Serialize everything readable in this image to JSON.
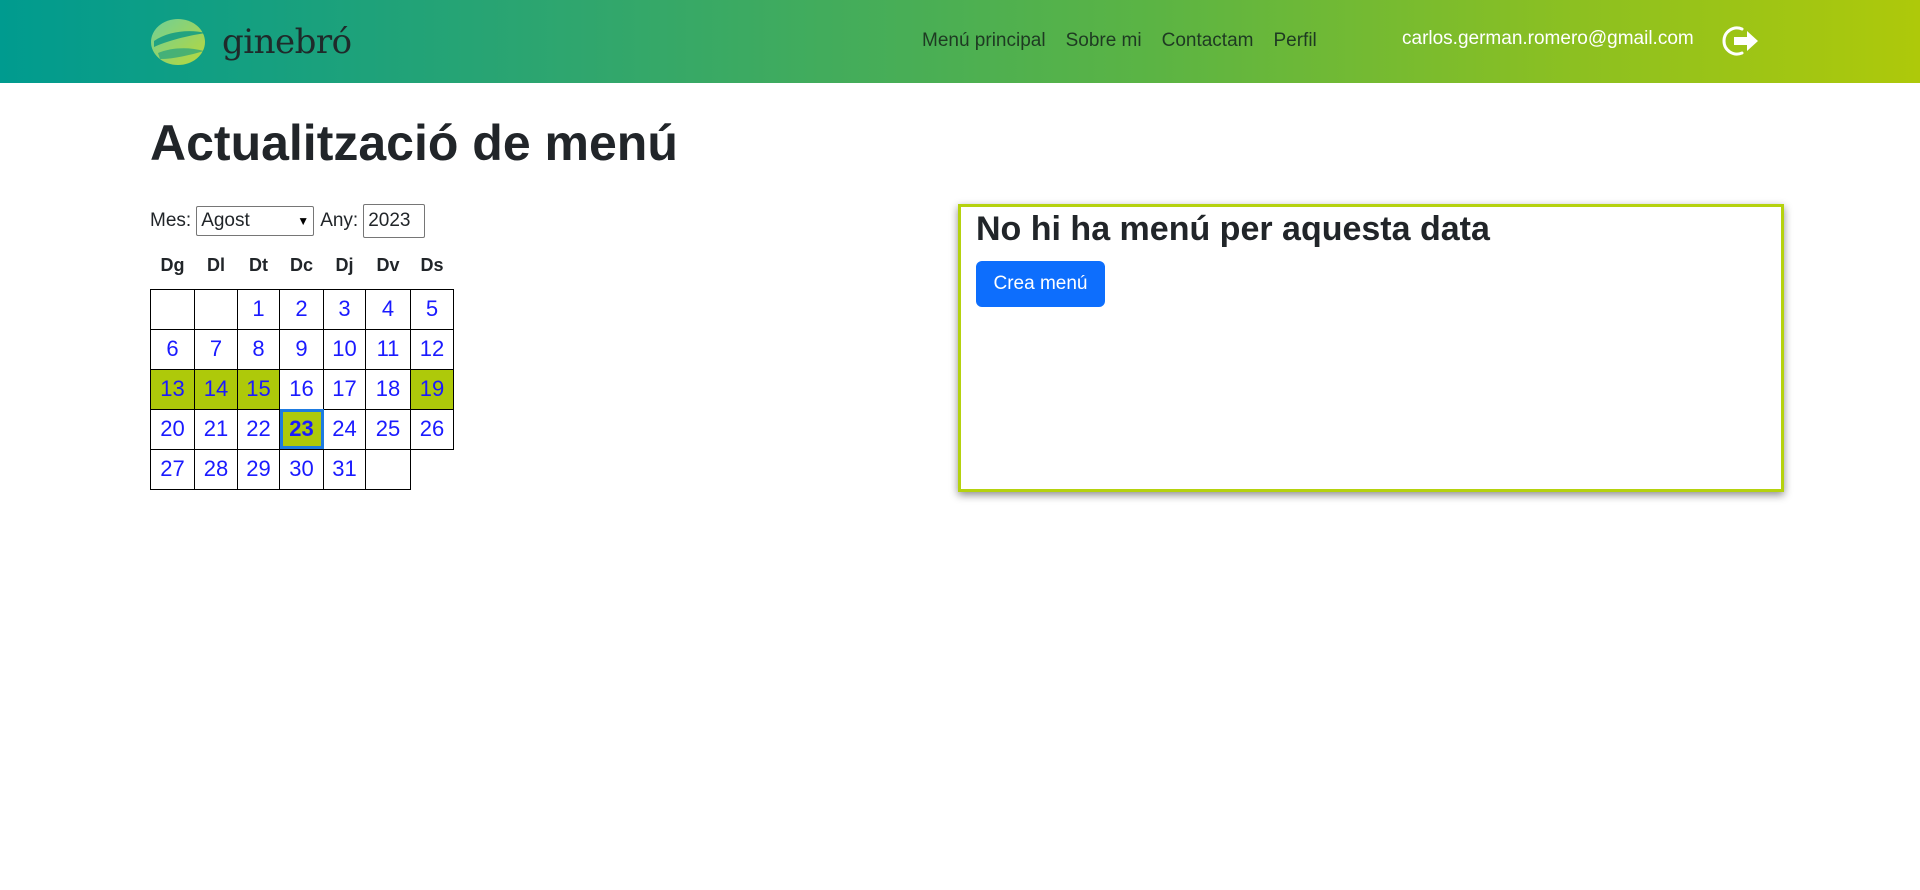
{
  "header": {
    "logo_text": "ginebró",
    "nav": [
      "Menú principal",
      "Sobre mi",
      "Contactam",
      "Perfil"
    ],
    "user_email": "carlos.german.romero@gmail.com",
    "colors": {
      "gradient_start": "#009b8f",
      "gradient_end": "#aec90a"
    }
  },
  "page": {
    "title": "Actualització de menú"
  },
  "filters": {
    "month_label": "Mes:",
    "month_value": "Agost",
    "year_label": "Any:",
    "year_value": "2023"
  },
  "calendar": {
    "weekdays": [
      "Dg",
      "Dl",
      "Dt",
      "Dc",
      "Dj",
      "Dv",
      "Ds"
    ],
    "weeks": [
      [
        "",
        "",
        "1",
        "2",
        "3",
        "4",
        "5"
      ],
      [
        "6",
        "7",
        "8",
        "9",
        "10",
        "11",
        "12"
      ],
      [
        "13",
        "14",
        "15",
        "16",
        "17",
        "18",
        "19"
      ],
      [
        "20",
        "21",
        "22",
        "23",
        "24",
        "25",
        "26"
      ],
      [
        "27",
        "28",
        "29",
        "30",
        "31",
        ""
      ]
    ],
    "highlighted_days": [
      "13",
      "14",
      "15",
      "19",
      "23"
    ],
    "selected_day": "23",
    "highlight_color": "#aec90a",
    "day_text_color": "#1a1aff"
  },
  "panel": {
    "message": "No hi ha menú per aquesta data",
    "create_button_label": "Crea menú",
    "border_color": "#b5d20e",
    "button_color": "#0d6efd"
  }
}
